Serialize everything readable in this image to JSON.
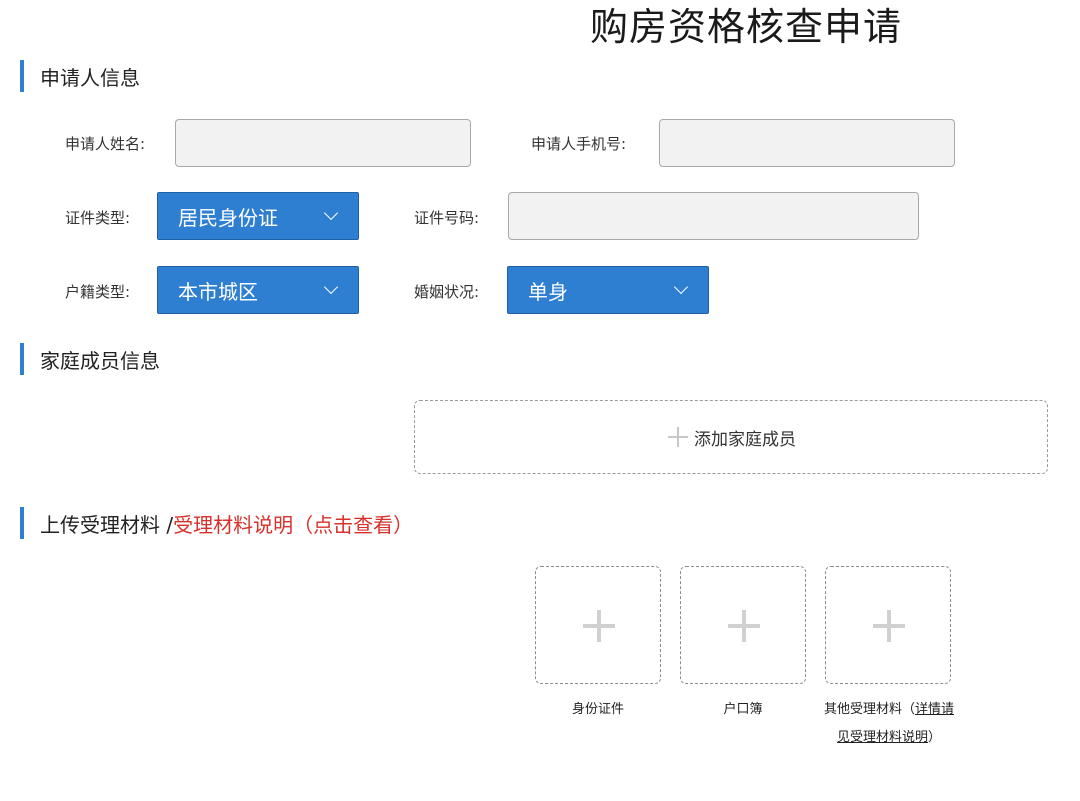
{
  "page_title": "购房资格核查申请",
  "sections": {
    "applicant": "申请人信息",
    "family": "家庭成员信息",
    "upload": {
      "title": "上传受理材料 /",
      "link": "受理材料说明（点击查看）"
    }
  },
  "applicant": {
    "name_label": "申请人姓名:",
    "name_value": "",
    "phone_label": "申请人手机号:",
    "phone_value": "",
    "id_type_label": "证件类型:",
    "id_type_value": "居民身份证",
    "id_number_label": "证件号码:",
    "id_number_value": "",
    "hukou_type_label": "户籍类型:",
    "hukou_type_value": "本市城区",
    "marital_label": "婚姻状况:",
    "marital_value": "单身"
  },
  "family": {
    "add_button_label": "添加家庭成员"
  },
  "uploads": [
    {
      "caption": "身份证件"
    },
    {
      "caption": "户口簿"
    },
    {
      "caption_prefix": "其他受理材料（",
      "caption_link": "详情请见受理材料说明",
      "caption_suffix": "）"
    }
  ],
  "icons": {
    "select_arrow": "chevron-down-icon",
    "add": "plus-icon"
  },
  "colors": {
    "accent": "#2e7fd1",
    "section_bar": "#2f7fd3",
    "highlight_red": "#d9302b",
    "input_bg": "#f2f2f2"
  }
}
